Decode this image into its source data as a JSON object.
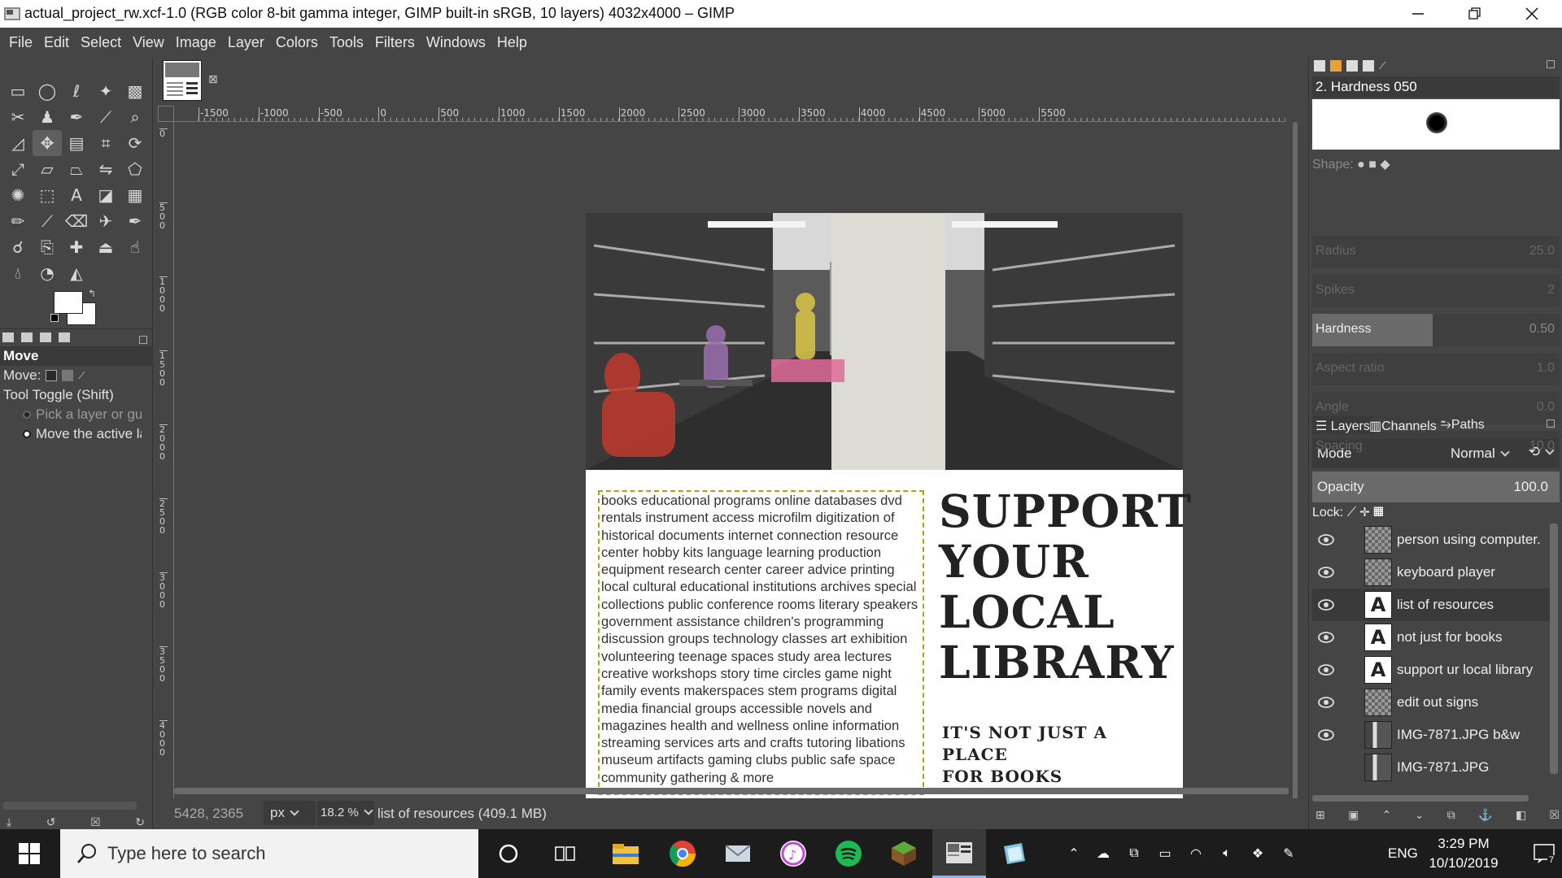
{
  "window": {
    "title": "actual_project_rw.xcf-1.0 (RGB color 8-bit gamma integer, GIMP built-in sRGB, 10 layers) 4032x4000 – GIMP"
  },
  "menubar": [
    "File",
    "Edit",
    "Select",
    "View",
    "Image",
    "Layer",
    "Colors",
    "Tools",
    "Filters",
    "Windows",
    "Help"
  ],
  "toolbox": {
    "active_tool": "move-tool",
    "tools": [
      "rect-select-icon",
      "ellipse-select-icon",
      "free-select-icon",
      "fuzzy-select-icon",
      "select-by-color-icon",
      "scissors-select-icon",
      "foreground-select-icon",
      "paths-icon",
      "color-picker-icon",
      "zoom-icon",
      "measure-icon",
      "move-tool",
      "align-icon",
      "crop-icon",
      "rotate-icon",
      "scale-icon",
      "shear-icon",
      "perspective-icon",
      "flip-icon",
      "cage-icon",
      "warp-icon",
      "unified-transform-icon",
      "text-icon",
      "bucket-fill-icon",
      "blend-icon",
      "pencil-icon",
      "paintbrush-icon",
      "eraser-icon",
      "airbrush-icon",
      "ink-icon",
      "mypaint-brush-icon",
      "clone-icon",
      "heal-icon",
      "perspective-clone-icon",
      "smudge-icon",
      "blur-icon",
      "dodge-burn-icon",
      "sharpen-icon"
    ],
    "fg_color": "#ffffff",
    "bg_color": "#ffffff"
  },
  "tool_options": {
    "title": "Move",
    "move_label": "Move:",
    "toggle_label": "Tool Toggle  (Shift)",
    "option1": "Pick a layer or guide",
    "option2": "Move the active layer"
  },
  "ruler": {
    "h_labels": [
      "-1500",
      "-1000",
      "-500",
      "0",
      "500",
      "1000",
      "1500",
      "2000",
      "2500",
      "3000",
      "3500",
      "4000",
      "4500",
      "5000",
      "5500"
    ],
    "v_labels": [
      "0",
      "500",
      "1000",
      "1500",
      "2000",
      "2500",
      "3000",
      "3500",
      "4000"
    ]
  },
  "document": {
    "resources_text": "books educational programs online databases dvd rentals instrument access microfilm digitization of historical documents internet connection resource center hobby kits language learning production equipment research center career advice printing local cultural educational institutions archives special collections public conference rooms literary speakers government assistance children's programming discussion groups technology classes art exhibition volunteering teenage spaces study area lectures creative workshops story time circles game night family events makerspaces stem programs digital media financial groups accessible novels and magazines health and wellness online information streaming services arts and crafts tutoring libations museum artifacts gaming clubs public safe space community gathering & more",
    "headline_lines": [
      "SUPPORT",
      "YOUR",
      "LOCAL",
      "LIBRARY"
    ],
    "sub_lines": [
      "IT'S NOT JUST A PLACE",
      "FOR BOOKS"
    ]
  },
  "statusbar": {
    "coords": "5428, 2365",
    "unit": "px",
    "zoom": "18.2 %",
    "message": "list of resources (409.1 MB)"
  },
  "brushes": {
    "name": "2. Hardness 050",
    "shape_label": "Shape:",
    "sliders": [
      {
        "label": "Radius",
        "value": "25.0",
        "active": false
      },
      {
        "label": "Spikes",
        "value": "2",
        "active": false
      },
      {
        "label": "Hardness",
        "value": "0.50",
        "active": true
      },
      {
        "label": "Aspect ratio",
        "value": "1.0",
        "active": false
      },
      {
        "label": "Angle",
        "value": "0.0",
        "active": false
      },
      {
        "label": "Spacing",
        "value": "10.0",
        "active": false
      }
    ]
  },
  "layers_panel": {
    "tabs": [
      "Layers",
      "Channels",
      "Paths"
    ],
    "mode_label": "Mode",
    "mode_value": "Normal",
    "opacity_label": "Opacity",
    "opacity_value": "100.0",
    "lock_label": "Lock:",
    "layers": [
      {
        "name": "person using computer.",
        "type": "image",
        "visible": true,
        "selected": false
      },
      {
        "name": "keyboard player",
        "type": "image",
        "visible": true,
        "selected": false
      },
      {
        "name": "list of resources",
        "type": "text",
        "visible": true,
        "selected": true
      },
      {
        "name": "not just for books",
        "type": "text",
        "visible": true,
        "selected": false
      },
      {
        "name": "support ur local library",
        "type": "text",
        "visible": true,
        "selected": false
      },
      {
        "name": "edit out signs",
        "type": "image",
        "visible": true,
        "selected": false
      },
      {
        "name": "IMG-7871.JPG b&w",
        "type": "photo",
        "visible": true,
        "selected": false
      },
      {
        "name": "IMG-7871.JPG",
        "type": "photo",
        "visible": false,
        "selected": false
      }
    ]
  },
  "taskbar": {
    "search_placeholder": "Type here to search",
    "apps": [
      "task-view-icon",
      "file-explorer-icon",
      "chrome-icon",
      "mail-icon",
      "itunes-icon",
      "spotify-icon",
      "minecraft-icon",
      "gimp-icon",
      "notepad-icon"
    ],
    "language": "ENG",
    "time": "3:29 PM",
    "date": "10/10/2019",
    "notification_count": "7"
  }
}
